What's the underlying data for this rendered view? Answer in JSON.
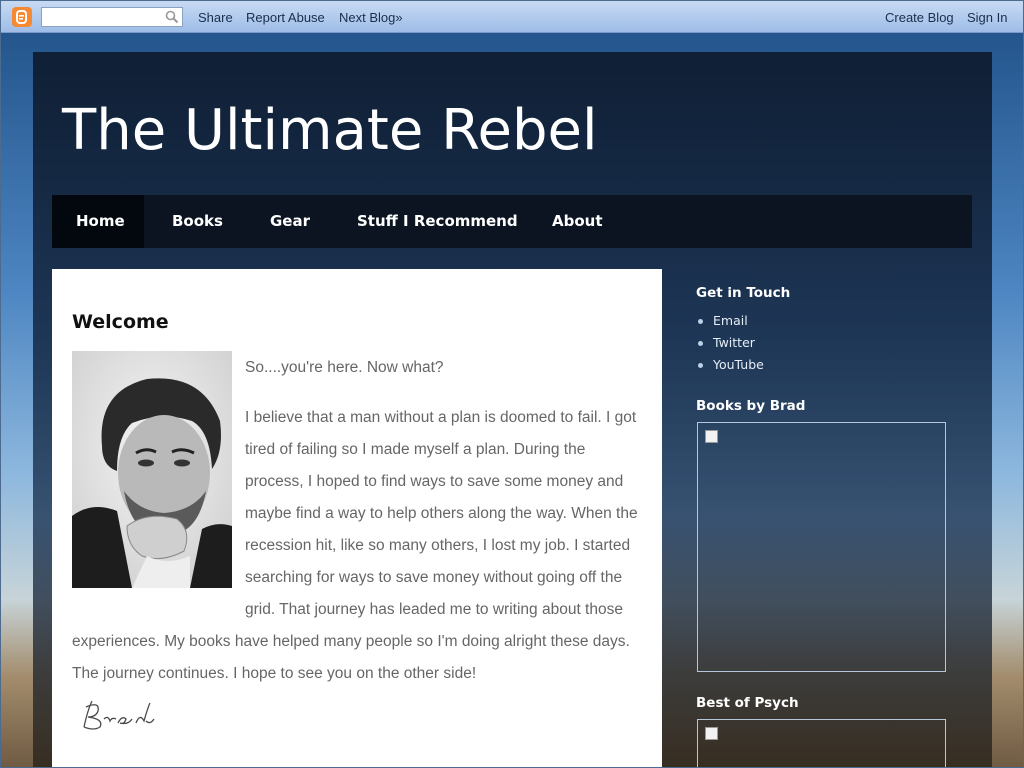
{
  "navbar": {
    "logo_icon": "blogger-logo-icon",
    "search_placeholder": "",
    "search_icon": "search-icon",
    "links_left": [
      "Share",
      "Report Abuse",
      "Next Blog»"
    ],
    "links_right": [
      "Create Blog",
      "Sign In"
    ]
  },
  "header": {
    "title": "The Ultimate Rebel"
  },
  "tabs": [
    {
      "label": "Home",
      "active": true
    },
    {
      "label": "Books",
      "active": false
    },
    {
      "label": "Gear",
      "active": false
    },
    {
      "label": "Stuff I Recommend",
      "active": false
    },
    {
      "label": "About",
      "active": false
    }
  ],
  "post": {
    "title": "Welcome",
    "paragraph1": "So....you're here. Now what?",
    "paragraph2": "I believe that a man without a plan is doomed to fail. I got tired of failing so I made myself a plan.  During the process, I hoped to find ways to save some money and maybe find a way to help others along the way. When the recession hit, like so many others, I lost my job.  I started searching for ways to save money without going off the grid. That journey has leaded me to writing about those experiences.   My books have helped many people so I'm doing alright these days. The journey continues.  I hope to see you on the other side!",
    "signature": "Brad"
  },
  "sidebar": {
    "contact_heading": "Get in Touch",
    "contact_links": [
      "Email",
      "Twitter",
      "YouTube"
    ],
    "books_heading": "Books by Brad",
    "psych_heading": "Best of Psych"
  },
  "colors": {
    "tab_bar": "#0b1420",
    "active_tab": "#03080f",
    "post_background": "#ffffff",
    "post_text": "#666666"
  }
}
